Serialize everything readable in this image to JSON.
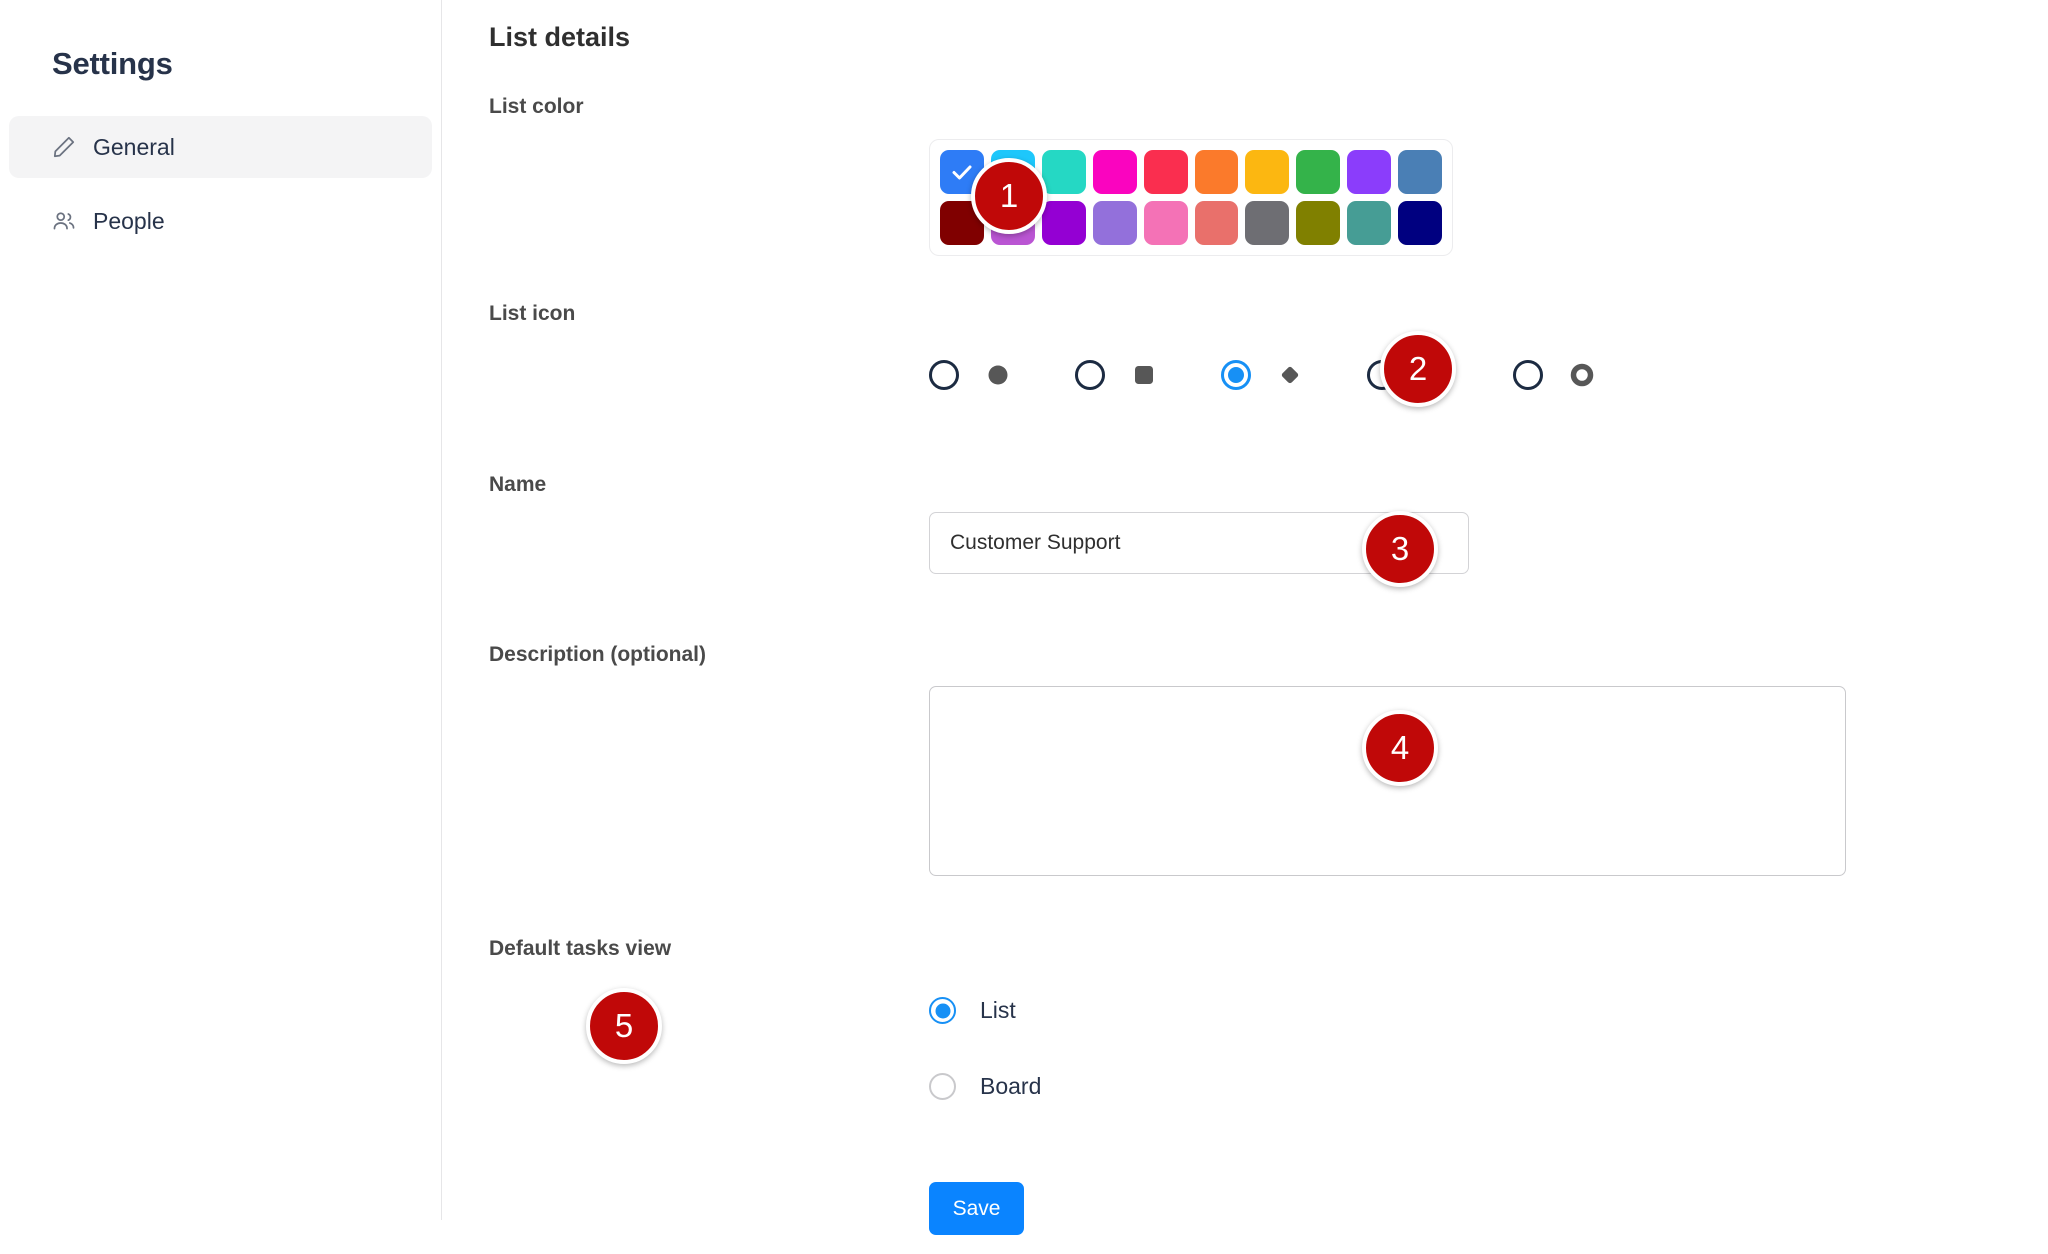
{
  "sidebar": {
    "title": "Settings",
    "items": [
      {
        "label": "General",
        "icon": "pencil-icon",
        "selected": true
      },
      {
        "label": "People",
        "icon": "people-icon",
        "selected": false
      }
    ]
  },
  "main": {
    "page_title": "List details",
    "labels": {
      "list_color": "List color",
      "list_icon": "List icon",
      "name": "Name",
      "description": "Description (optional)",
      "default_view": "Default tasks view"
    },
    "list_color": {
      "selected_index": 0,
      "rows": [
        [
          "#2e7cf6",
          "#1ec7fb",
          "#25d8c4",
          "#fa04bf",
          "#fa2e4f",
          "#fb7a2b",
          "#fcb711",
          "#34b34a",
          "#8b3dfb",
          "#4a7fb5"
        ],
        [
          "#800000",
          "#ba55d3",
          "#9400d3",
          "#9370db",
          "#f472b6",
          "#e9706b",
          "#6e6e73",
          "#808000",
          "#469d95",
          "#000080"
        ]
      ]
    },
    "list_icon": {
      "selected_index": 2,
      "options": [
        {
          "name": "circle-icon"
        },
        {
          "name": "square-icon"
        },
        {
          "name": "diamond-icon"
        },
        {
          "name": "target-icon"
        },
        {
          "name": "donut-icon"
        }
      ]
    },
    "name_field": {
      "value": "Customer Support",
      "placeholder": ""
    },
    "description_field": {
      "value": "",
      "placeholder": ""
    },
    "default_view": {
      "selected": "List",
      "options": [
        {
          "label": "List",
          "checked": true
        },
        {
          "label": "Board",
          "checked": false
        }
      ]
    },
    "save_label": "Save"
  },
  "annotations": [
    {
      "number": "1"
    },
    {
      "number": "2"
    },
    {
      "number": "3"
    },
    {
      "number": "4"
    },
    {
      "number": "5"
    }
  ],
  "colors": {
    "accent": "#0a84ff",
    "badge": "#c00808",
    "radio_outline": "#1c2b42"
  }
}
